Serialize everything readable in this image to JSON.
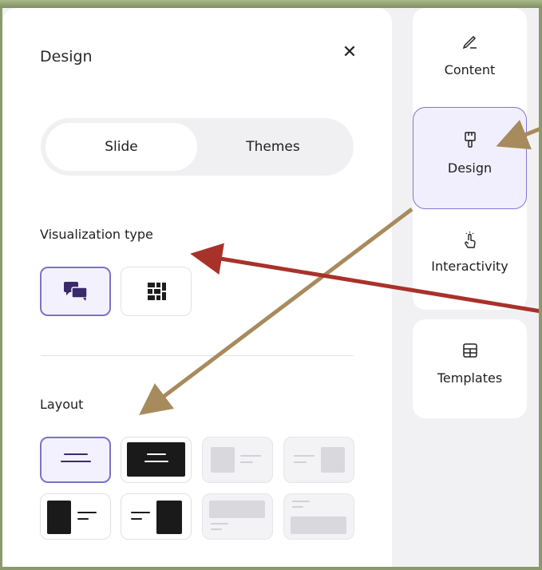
{
  "panel": {
    "title": "Design",
    "close_icon": "close-icon",
    "tabs": [
      {
        "label": "Slide",
        "active": true
      },
      {
        "label": "Themes",
        "active": false
      }
    ],
    "visualization": {
      "label": "Visualization type",
      "options": [
        {
          "icon": "speech-bubbles-icon",
          "selected": true
        },
        {
          "icon": "grid-blocks-icon",
          "selected": false
        }
      ]
    },
    "layout": {
      "label": "Layout",
      "options": [
        {
          "name": "centered-text",
          "selected": true,
          "disabled": false
        },
        {
          "name": "centered-text-dark-bg",
          "selected": false,
          "disabled": false
        },
        {
          "name": "image-left-text-right",
          "selected": false,
          "disabled": true
        },
        {
          "name": "text-left-image-right",
          "selected": false,
          "disabled": true
        },
        {
          "name": "dark-block-left-text-right",
          "selected": false,
          "disabled": false
        },
        {
          "name": "text-left-dark-block-right",
          "selected": false,
          "disabled": false
        },
        {
          "name": "image-top-text-bottom",
          "selected": false,
          "disabled": true
        },
        {
          "name": "text-top-image-bottom",
          "selected": false,
          "disabled": true
        }
      ]
    }
  },
  "sidebar": {
    "items": [
      {
        "label": "Content",
        "icon": "pencil-icon",
        "active": false
      },
      {
        "label": "Design",
        "icon": "paint-brush-icon",
        "active": true
      },
      {
        "label": "Interactivity",
        "icon": "tap-hand-icon",
        "active": false
      },
      {
        "label": "Templates",
        "icon": "table-grid-icon",
        "active": false
      }
    ]
  },
  "colors": {
    "accent": "#7b72c9",
    "accent_bg": "#f3f1fd",
    "annotation_tan": "#a88b5c",
    "annotation_red": "#a8322a",
    "icon_purple": "#3b2a6b"
  }
}
